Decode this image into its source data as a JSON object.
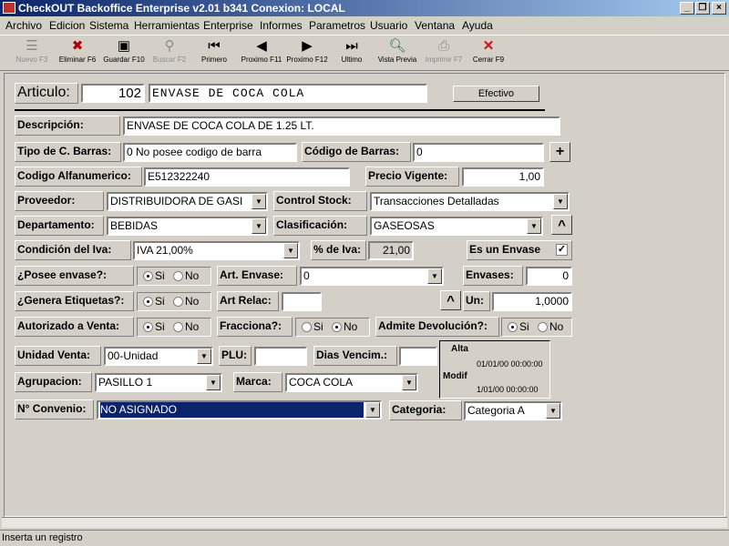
{
  "window": {
    "title": "CheckOUT Backoffice Enterprise v2.01 b341 Conexion: LOCAL"
  },
  "menu": [
    "Archivo",
    "Edicion",
    "Sistema",
    "Herramientas",
    "Enterprise",
    "Informes",
    "Parametros",
    "Usuario",
    "Ventana",
    "Ayuda"
  ],
  "toolbar": {
    "nuevo": "Nuevo F3",
    "eliminar": "Eliminar F6",
    "guardar": "Guardar F10",
    "buscar": "Buscar F2",
    "primero": "Primero",
    "prox11": "Proximo F11",
    "prox12": "Proximo F12",
    "ultimo": "Ultimo",
    "vista": "Vista Previa",
    "imprimir": "Imprimir F7",
    "cerrar": "Cerrar F9"
  },
  "form": {
    "articulo_label": "Articulo:",
    "articulo_num": "102",
    "articulo_nombre": "ENVASE DE COCA COLA",
    "efectivo": "Efectivo",
    "descripcion_label": "Descripción:",
    "descripcion": "ENVASE DE COCA COLA DE 1.25 LT.",
    "tipo_barras_label": "Tipo de C. Barras:",
    "tipo_barras": "0 No posee codigo de barra",
    "codigo_barras_label": "Código de Barras:",
    "codigo_barras": "0",
    "plus": "+",
    "alfa_label": "Codigo Alfanumerico:",
    "alfa": "E512322240",
    "precio_label": "Precio Vigente:",
    "precio": "1,00",
    "proveedor_label": "Proveedor:",
    "proveedor": "DISTRIBUIDORA DE GASI",
    "control_label": "Control Stock:",
    "control": "Transacciones Detalladas",
    "depto_label": "Departamento:",
    "depto": "BEBIDAS",
    "clasif_label": "Clasificación:",
    "clasif": "GASEOSAS",
    "caret": "^",
    "iva_label": "Condición del Iva:",
    "iva": "IVA 21,00%",
    "pct_iva_label": "% de Iva:",
    "pct_iva": "21,00",
    "envase_label": "Es un Envase",
    "envase_check": "✓",
    "posee_label": "¿Posee envase?:",
    "art_envase_label": "Art. Envase:",
    "art_envase": "0",
    "envases_label": "Envases:",
    "envases": "0",
    "genera_label": "¿Genera Etiquetas?:",
    "art_relac_label": "Art Relac:",
    "art_relac": "",
    "un_label": "Un:",
    "un": "1,0000",
    "autorizado_label": "Autorizado a Venta:",
    "fracciona_label": "Fracciona?:",
    "admite_label": "Admite Devolución?:",
    "si": "Si",
    "no": "No",
    "unidad_label": "Unidad Venta:",
    "unidad": "00-Unidad",
    "plu_label": "PLU:",
    "plu": "",
    "dias_label": "Dias Vencim.:",
    "dias": "",
    "alta_label": "Alta",
    "alta": "01/01/00 00:00:00",
    "modif_label": "Modif",
    "modif": "1/01/00 00:00:00",
    "agrup_label": "Agrupacion:",
    "agrup": "PASILLO 1",
    "marca_label": "Marca:",
    "marca": "COCA COLA",
    "convenio_label": "N° Convenio:",
    "convenio": "NO ASIGNADO",
    "categoria_label": "Categoria:",
    "categoria": "Categoria A"
  },
  "status": {
    "text": "Inserta un registro"
  }
}
